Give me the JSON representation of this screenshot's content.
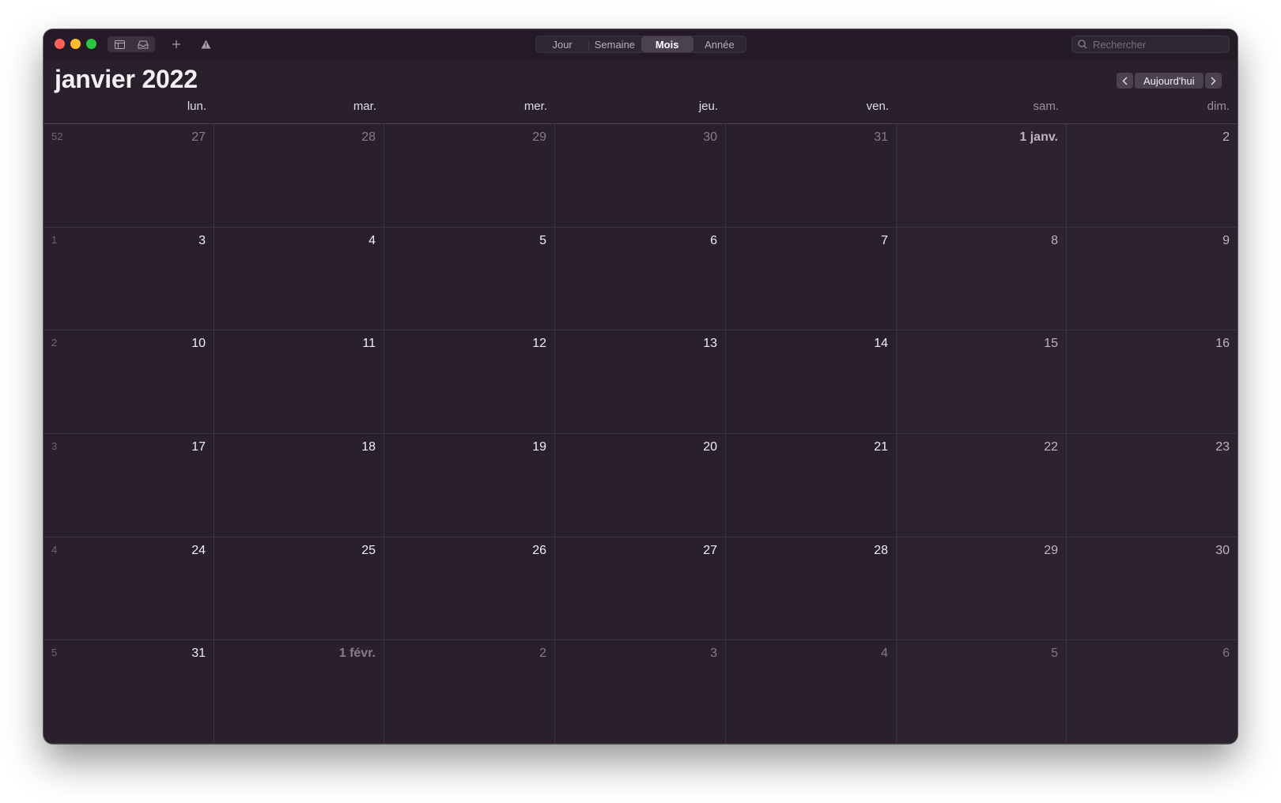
{
  "toolbar": {
    "icons": [
      "calendar-list-icon",
      "inbox-icon",
      "plus-icon",
      "warning-icon"
    ],
    "views": [
      {
        "label": "Jour",
        "active": false
      },
      {
        "label": "Semaine",
        "active": false
      },
      {
        "label": "Mois",
        "active": true
      },
      {
        "label": "Année",
        "active": false
      }
    ],
    "search_placeholder": "Rechercher"
  },
  "header": {
    "month_title": "janvier 2022",
    "today_label": "Aujourd'hui"
  },
  "weekdays": [
    "lun.",
    "mar.",
    "mer.",
    "jeu.",
    "ven.",
    "sam.",
    "dim."
  ],
  "weeks": [
    {
      "week_number": "52",
      "days": [
        {
          "label": "27",
          "current_month": false
        },
        {
          "label": "28",
          "current_month": false
        },
        {
          "label": "29",
          "current_month": false
        },
        {
          "label": "30",
          "current_month": false
        },
        {
          "label": "31",
          "current_month": false
        },
        {
          "label": "1 janv.",
          "current_month": true
        },
        {
          "label": "2",
          "current_month": true
        }
      ]
    },
    {
      "week_number": "1",
      "days": [
        {
          "label": "3",
          "current_month": true
        },
        {
          "label": "4",
          "current_month": true
        },
        {
          "label": "5",
          "current_month": true
        },
        {
          "label": "6",
          "current_month": true
        },
        {
          "label": "7",
          "current_month": true
        },
        {
          "label": "8",
          "current_month": true
        },
        {
          "label": "9",
          "current_month": true
        }
      ]
    },
    {
      "week_number": "2",
      "days": [
        {
          "label": "10",
          "current_month": true
        },
        {
          "label": "11",
          "current_month": true
        },
        {
          "label": "12",
          "current_month": true
        },
        {
          "label": "13",
          "current_month": true
        },
        {
          "label": "14",
          "current_month": true
        },
        {
          "label": "15",
          "current_month": true
        },
        {
          "label": "16",
          "current_month": true
        }
      ]
    },
    {
      "week_number": "3",
      "days": [
        {
          "label": "17",
          "current_month": true
        },
        {
          "label": "18",
          "current_month": true
        },
        {
          "label": "19",
          "current_month": true
        },
        {
          "label": "20",
          "current_month": true
        },
        {
          "label": "21",
          "current_month": true
        },
        {
          "label": "22",
          "current_month": true
        },
        {
          "label": "23",
          "current_month": true
        }
      ]
    },
    {
      "week_number": "4",
      "days": [
        {
          "label": "24",
          "current_month": true
        },
        {
          "label": "25",
          "current_month": true
        },
        {
          "label": "26",
          "current_month": true
        },
        {
          "label": "27",
          "current_month": true
        },
        {
          "label": "28",
          "current_month": true
        },
        {
          "label": "29",
          "current_month": true
        },
        {
          "label": "30",
          "current_month": true
        }
      ]
    },
    {
      "week_number": "5",
      "days": [
        {
          "label": "31",
          "current_month": true
        },
        {
          "label": "1 févr.",
          "current_month": false
        },
        {
          "label": "2",
          "current_month": false
        },
        {
          "label": "3",
          "current_month": false
        },
        {
          "label": "4",
          "current_month": false
        },
        {
          "label": "5",
          "current_month": false
        },
        {
          "label": "6",
          "current_month": false
        }
      ]
    }
  ],
  "colors": {
    "close": "#fe5f57",
    "minimize": "#febc2e",
    "maximize": "#28c840",
    "window_background": "#2a1f2c"
  }
}
